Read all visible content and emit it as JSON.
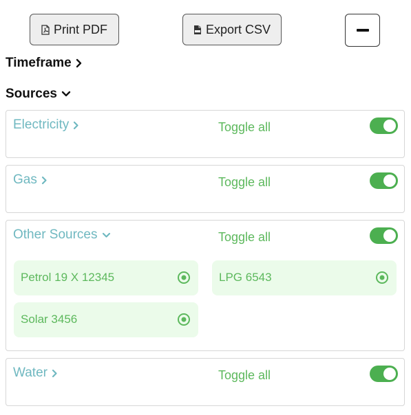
{
  "toolbar": {
    "print_label": "Print PDF",
    "export_label": "Export CSV"
  },
  "headings": {
    "timeframe": "Timeframe",
    "sources": "Sources"
  },
  "sources": [
    {
      "title": "Electricity",
      "toggle_label": "Toggle all",
      "toggle_on": true,
      "expanded": false
    },
    {
      "title": "Gas",
      "toggle_label": "Toggle all",
      "toggle_on": true,
      "expanded": false
    },
    {
      "title": "Other Sources",
      "toggle_label": "Toggle all",
      "toggle_on": true,
      "expanded": true,
      "items": [
        {
          "label": "Petrol 19 X 12345",
          "selected": true
        },
        {
          "label": "LPG 6543",
          "selected": true
        },
        {
          "label": "Solar 3456",
          "selected": true
        }
      ]
    },
    {
      "title": "Water",
      "toggle_label": "Toggle all",
      "toggle_on": true,
      "expanded": false
    }
  ],
  "colors": {
    "accent_green": "#4caf50",
    "label_green": "#5cb85c",
    "chip_background": "#ebfbea",
    "title_teal": "#6fb8c0"
  },
  "icons": {
    "print": "pdf-file-icon",
    "export": "csv-file-icon",
    "collapse": "minus-icon",
    "collapsed": "chevron-right-icon",
    "expanded": "chevron-down-icon",
    "item_selected": "radio-selected-icon"
  }
}
